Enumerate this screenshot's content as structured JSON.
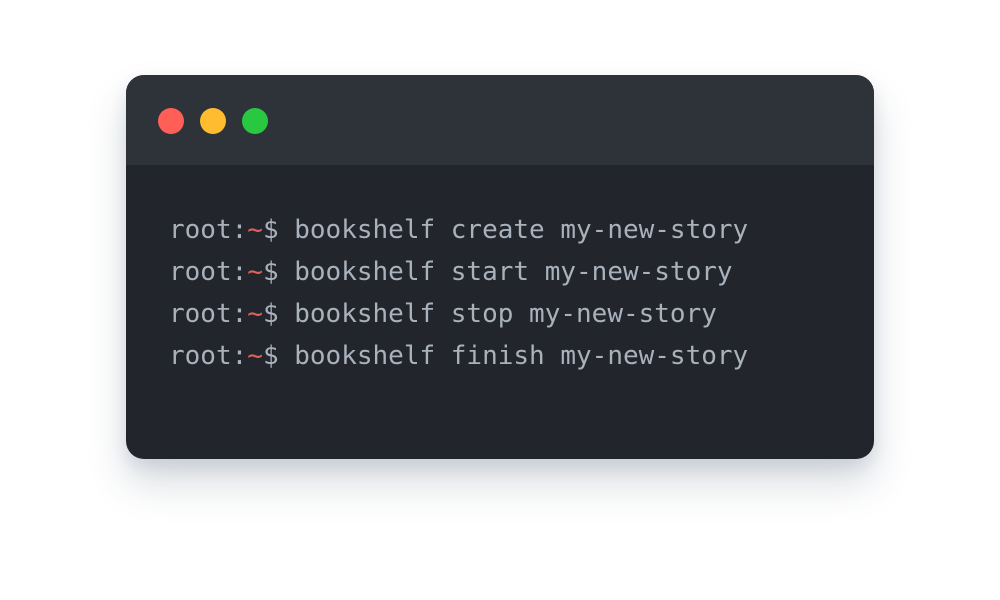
{
  "colors": {
    "close": "#ff5f57",
    "minimize": "#febc2e",
    "maximize": "#28c840",
    "tilde": "#e0625a",
    "text": "#a9b1bc"
  },
  "terminal": {
    "lines": [
      {
        "user": "root:",
        "path": "~",
        "symbol": "$",
        "command": " bookshelf create my-new-story"
      },
      {
        "user": "root:",
        "path": "~",
        "symbol": "$",
        "command": " bookshelf start my-new-story"
      },
      {
        "user": "root:",
        "path": "~",
        "symbol": "$",
        "command": " bookshelf stop my-new-story"
      },
      {
        "user": "root:",
        "path": "~",
        "symbol": "$",
        "command": " bookshelf finish my-new-story"
      }
    ]
  }
}
